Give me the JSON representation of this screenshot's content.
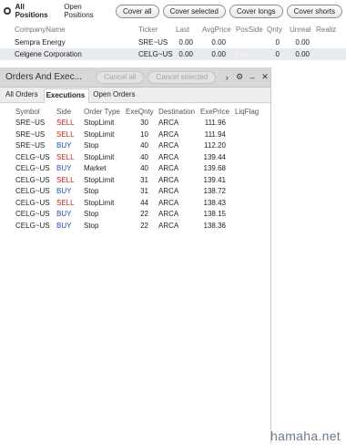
{
  "positions": {
    "tabs": [
      "All Positions",
      "Open Positions"
    ],
    "buttons": [
      "Cover all",
      "Cover selected",
      "Cover longs",
      "Cover shorts"
    ],
    "columns": [
      "CompanyName",
      "Ticker",
      "Last",
      "AvgPrice",
      "PosSide",
      "Qnty",
      "Unreal",
      "Realiz"
    ],
    "rows": [
      {
        "company": "Sempra Energy",
        "ticker": "SRE~US",
        "last": "0.00",
        "avg": "0.00",
        "side": "",
        "qnty": "0",
        "unreal": "0.00"
      },
      {
        "company": "Celgene Corporation",
        "ticker": "CELG~US",
        "last": "0.00",
        "avg": "0.00",
        "side": "Flat",
        "qnty": "0",
        "unreal": "0.00"
      }
    ]
  },
  "orders": {
    "title": "Orders And Exec...",
    "buttons": [
      "Cancel all",
      "Cancel selected"
    ],
    "icons": [
      "chevron-right-icon",
      "gear-icon",
      "minus-icon",
      "close-icon"
    ],
    "tabs": [
      "All Orders",
      "Executions",
      "Open Orders"
    ],
    "columns": [
      "Symbol",
      "Side",
      "Order Type",
      "ExeQnty",
      "Destination",
      "ExePrice",
      "LiqFlag"
    ],
    "rows": [
      {
        "symbol": "SRE~US",
        "side": "SELL",
        "type": "StopLimit",
        "qty": "30",
        "dest": "ARCA",
        "price": "111.96"
      },
      {
        "symbol": "SRE~US",
        "side": "SELL",
        "type": "StopLimit",
        "qty": "10",
        "dest": "ARCA",
        "price": "111.94"
      },
      {
        "symbol": "SRE~US",
        "side": "BUY",
        "type": "Stop",
        "qty": "40",
        "dest": "ARCA",
        "price": "112.20"
      },
      {
        "symbol": "CELG~US",
        "side": "SELL",
        "type": "StopLimit",
        "qty": "40",
        "dest": "ARCA",
        "price": "139.44"
      },
      {
        "symbol": "CELG~US",
        "side": "BUY",
        "type": "Market",
        "qty": "40",
        "dest": "ARCA",
        "price": "139.68"
      },
      {
        "symbol": "CELG~US",
        "side": "SELL",
        "type": "StopLimit",
        "qty": "31",
        "dest": "ARCA",
        "price": "139.41"
      },
      {
        "symbol": "CELG~US",
        "side": "BUY",
        "type": "Stop",
        "qty": "31",
        "dest": "ARCA",
        "price": "138.72"
      },
      {
        "symbol": "CELG~US",
        "side": "SELL",
        "type": "StopLimit",
        "qty": "44",
        "dest": "ARCA",
        "price": "138.43"
      },
      {
        "symbol": "CELG~US",
        "side": "BUY",
        "type": "Stop",
        "qty": "22",
        "dest": "ARCA",
        "price": "138.15"
      },
      {
        "symbol": "CELG~US",
        "side": "BUY",
        "type": "Stop",
        "qty": "22",
        "dest": "ARCA",
        "price": "138.36"
      }
    ]
  },
  "watermark": "hamaha.net",
  "colors": {
    "sell": "#d01f1f",
    "buy": "#1f4fb8"
  }
}
